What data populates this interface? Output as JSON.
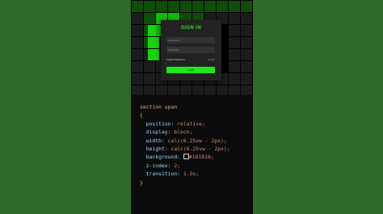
{
  "card": {
    "title": "SIGN IN",
    "username_placeholder": "Username",
    "password_placeholder": "Password",
    "forgot_label": "Forget Password",
    "signup_label": "Signup",
    "login_label": "Login"
  },
  "code": {
    "selector": "section span",
    "open_brace": "{",
    "close_brace": "}",
    "lines": [
      {
        "prop": "position:",
        "value": "relative;"
      },
      {
        "prop": "display:",
        "value": "block;"
      },
      {
        "prop": "width:",
        "value": "calc(6.25vw - 2px);"
      },
      {
        "prop": "height:",
        "value": "calc(6.25vw - 2px);"
      },
      {
        "prop": "background:",
        "value": "#181818;"
      },
      {
        "prop": "z-index:",
        "value": "2;"
      },
      {
        "prop": "transition:",
        "value": "1.5s;"
      }
    ]
  },
  "colors": {
    "accent_green": "#2ee01d",
    "page_bg": "#2f6a2a",
    "phone_bg": "#0b0b0b",
    "swatch": "#181818"
  }
}
